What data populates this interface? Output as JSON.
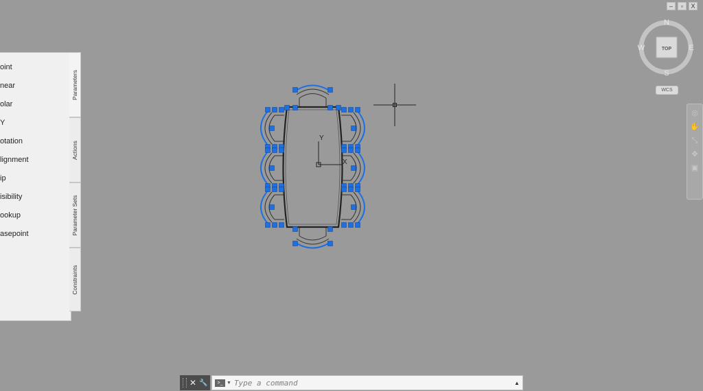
{
  "window": {
    "minimize": "–",
    "restore": "▫",
    "close": "X"
  },
  "palette": {
    "items": [
      "oint",
      "near",
      "olar",
      "Y",
      "otation",
      "lignment",
      "ip",
      "isibility",
      "ookup",
      "asepoint"
    ],
    "tabs": [
      "Parameters",
      "Actions",
      "Parameter Sets",
      "Constraints"
    ]
  },
  "drawing": {
    "ucs_x_label": "X",
    "ucs_y_label": "Y"
  },
  "viewcube": {
    "north": "N",
    "south": "S",
    "east": "E",
    "west": "W",
    "face": "TOP",
    "coord_system": "WCS"
  },
  "navbar": {
    "icons": [
      "steering-wheel-icon",
      "pan-icon",
      "zoom-icon",
      "orbit-icon",
      "showmotion-icon"
    ]
  },
  "command": {
    "placeholder": "Type a command",
    "close": "✕",
    "settings": "🔧",
    "prompt_icon": ">_"
  },
  "colors": {
    "grip_blue": "#1e6fe0",
    "background": "#9a9a9a"
  }
}
